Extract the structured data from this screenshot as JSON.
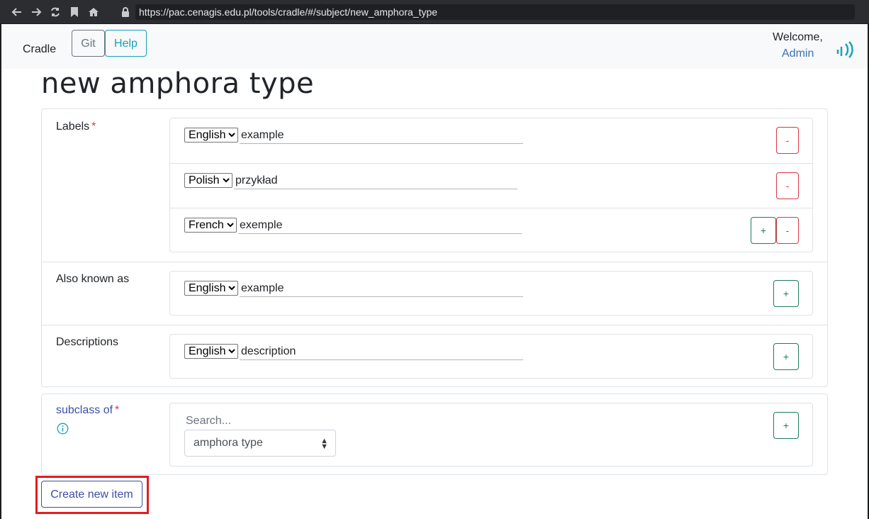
{
  "browser": {
    "url": "https://pac.cenagis.edu.pl/tools/cradle/#/subject/new_amphora_type"
  },
  "navbar": {
    "brand": "Cradle",
    "git_label": "Git",
    "help_label": "Help",
    "welcome": "Welcome,",
    "user": "Admin"
  },
  "page": {
    "title": "new amphora type"
  },
  "labels_section": {
    "label": "Labels",
    "required_mark": "*",
    "entries": [
      {
        "lang": "English",
        "value": "example"
      },
      {
        "lang": "Polish",
        "value": "przykład"
      },
      {
        "lang": "French",
        "value": "exemple"
      }
    ]
  },
  "aka_section": {
    "label": "Also known as",
    "entries": [
      {
        "lang": "English",
        "value": "example"
      }
    ]
  },
  "descriptions_section": {
    "label": "Descriptions",
    "entries": [
      {
        "lang": "English",
        "value": "description"
      }
    ]
  },
  "subclass_section": {
    "label": "subclass of",
    "required_mark": "*",
    "search_placeholder": "Search...",
    "selected": "amphora type"
  },
  "buttons": {
    "minus": "-",
    "plus": "+",
    "create": "Create new item"
  },
  "colors": {
    "chrome_bg": "#2b2d31",
    "navbar_bg": "#f8f9fa",
    "danger": "#dc3545",
    "success": "#28a745",
    "info": "#17a2b8",
    "primary": "#3d4fa3",
    "highlight": "#e01f1f"
  },
  "icons": [
    "back-icon",
    "forward-icon",
    "reload-icon",
    "bookmark-icon",
    "home-icon",
    "lock-icon",
    "app-logo-icon",
    "info-icon"
  ]
}
